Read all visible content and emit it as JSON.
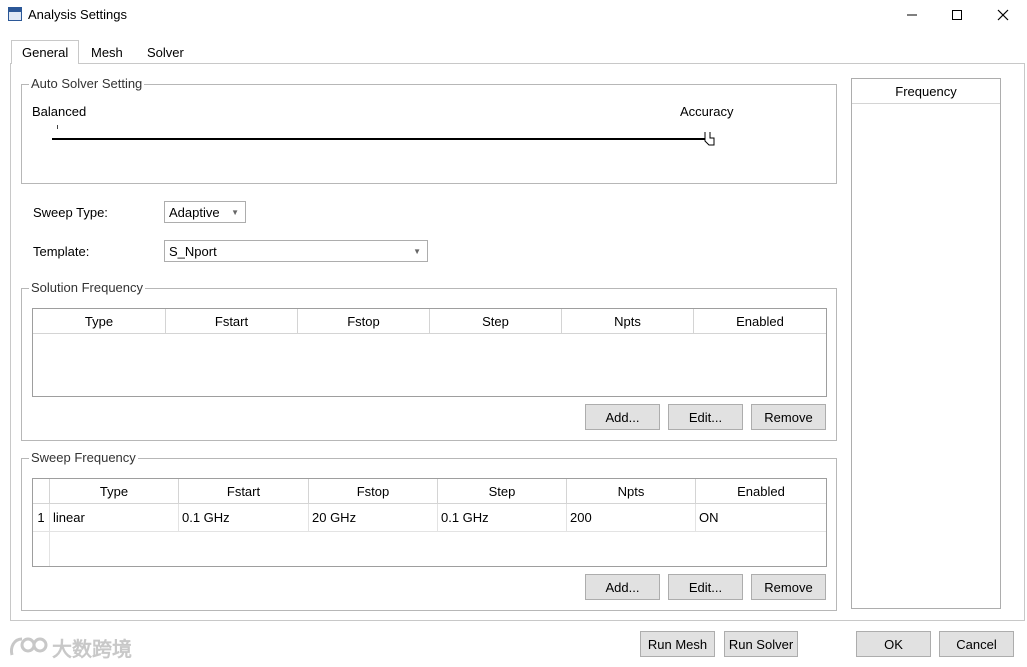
{
  "window": {
    "title": "Analysis Settings",
    "minimize": "—",
    "maximize": "☐",
    "close": "✕"
  },
  "tabs": [
    {
      "label": "General"
    },
    {
      "label": "Mesh"
    },
    {
      "label": "Solver"
    }
  ],
  "auto_solver": {
    "title": "Auto Solver Setting",
    "left_label": "Balanced",
    "right_label": "Accuracy",
    "slider_level": 1.0
  },
  "sweep_type": {
    "label": "Sweep Type:",
    "value": "Adaptive"
  },
  "template": {
    "label": "Template:",
    "value": "S_Nport"
  },
  "solution_frequency": {
    "title": "Solution Frequency",
    "columns": [
      "Type",
      "Fstart",
      "Fstop",
      "Step",
      "Npts",
      "Enabled"
    ],
    "rows": [],
    "add": "Add...",
    "edit": "Edit...",
    "remove": "Remove"
  },
  "sweep_frequency": {
    "title": "Sweep Frequency",
    "columns": [
      "Type",
      "Fstart",
      "Fstop",
      "Step",
      "Npts",
      "Enabled"
    ],
    "rows": [
      {
        "index": "1",
        "cells": [
          "linear",
          "0.1 GHz",
          "20 GHz",
          "0.1 GHz",
          "200",
          "ON"
        ]
      }
    ],
    "add": "Add...",
    "edit": "Edit...",
    "remove": "Remove"
  },
  "frequency_panel": {
    "header": "Frequency"
  },
  "footer": {
    "run_mesh": "Run Mesh",
    "run_solver": "Run Solver",
    "ok": "OK",
    "cancel": "Cancel"
  },
  "watermark": {
    "text": "大数跨境"
  }
}
